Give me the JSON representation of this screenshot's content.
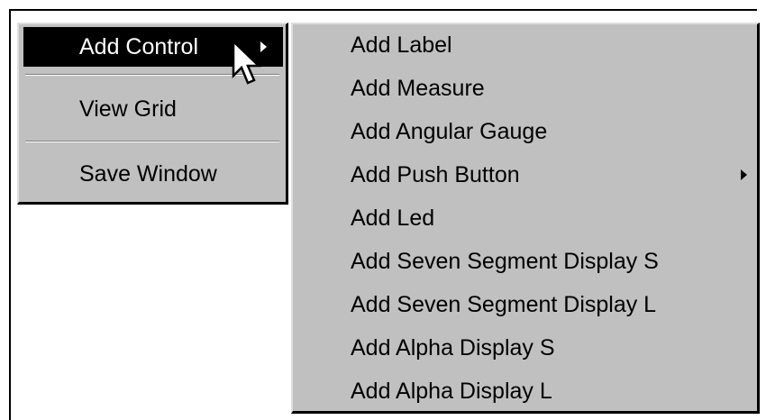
{
  "main_menu": {
    "items": [
      {
        "label": "Add Control",
        "highlighted": true,
        "has_submenu": true
      },
      {
        "label": "View Grid",
        "highlighted": false,
        "has_submenu": false
      },
      {
        "label": "Save Window",
        "highlighted": false,
        "has_submenu": false
      }
    ]
  },
  "submenu": {
    "items": [
      {
        "label": "Add Label",
        "has_submenu": false
      },
      {
        "label": "Add Measure",
        "has_submenu": false
      },
      {
        "label": "Add Angular Gauge",
        "has_submenu": false
      },
      {
        "label": "Add Push Button",
        "has_submenu": true
      },
      {
        "label": "Add Led",
        "has_submenu": false
      },
      {
        "label": "Add Seven Segment Display S",
        "has_submenu": false
      },
      {
        "label": "Add Seven Segment Display L",
        "has_submenu": false
      },
      {
        "label": "Add Alpha Display S",
        "has_submenu": false
      },
      {
        "label": "Add Alpha Display L",
        "has_submenu": false
      }
    ]
  },
  "colors": {
    "menu_background": "#c0c0c0",
    "highlight_background": "#000000",
    "highlight_text": "#ffffff",
    "text": "#000000"
  },
  "cursor": {
    "icon": "mouse-pointer-icon"
  }
}
